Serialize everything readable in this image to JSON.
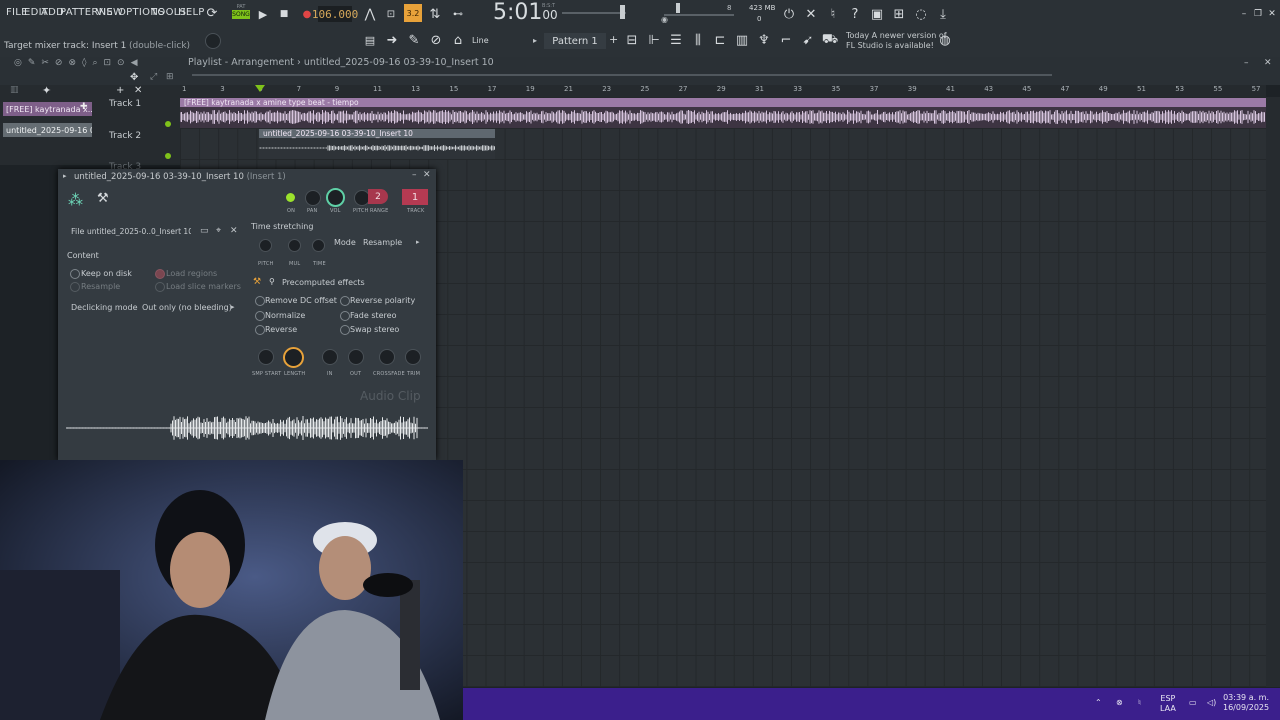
{
  "menu": [
    "FILE",
    "EDIT",
    "ADD",
    "PATTERNS",
    "VIEW",
    "OPTIONS",
    "TOOLS",
    "HELP"
  ],
  "song_mode": {
    "top": "PAT",
    "bottom": "SONG"
  },
  "bpm": "106.000",
  "step_display": "3.2",
  "time": {
    "main": "5:01",
    "sub": "00",
    "bar_label": "B:S:T"
  },
  "cpu": {
    "value": "8",
    "memory": "423 MB",
    "voices": "0"
  },
  "hint": {
    "left": "Target mixer track: Insert 1",
    "right": "(double-click)"
  },
  "tool_mode": "Line",
  "pattern": "Pattern 1",
  "news": {
    "line1": "Today  A newer version of",
    "line2": "FL Studio is available!"
  },
  "playlist": {
    "title": "Playlist - Arrangement",
    "separator": "›",
    "pattern_name": "untitled_2025-09-16 03-39-10_Insert 10",
    "ruler": [
      "1",
      "3",
      "5",
      "7",
      "9",
      "11",
      "13",
      "15",
      "17",
      "19",
      "21",
      "23",
      "25",
      "27",
      "29",
      "31",
      "33",
      "35",
      "37",
      "39",
      "41",
      "43",
      "45",
      "47",
      "49",
      "51",
      "53",
      "55",
      "57"
    ],
    "picker": [
      {
        "label": "[FREE] kaytranada x..."
      },
      {
        "label": "untitled_2025-09-16 03-..."
      }
    ],
    "tracks": [
      "Track 1",
      "Track 2",
      "Track 3"
    ],
    "clips": [
      {
        "label": "[FREE] kaytranada x amine type beat - tiempo",
        "color": "#9b7aa6"
      },
      {
        "label": "untitled_2025-09-16 03-39-10_Insert 10",
        "color": "#5f6870"
      }
    ]
  },
  "channel": {
    "title": "untitled_2025-09-16 03-39-10_Insert 10",
    "subtitle": "(Insert 1)",
    "knob_labels": [
      "ON",
      "PAN",
      "VOL",
      "PITCH",
      "RANGE",
      "TRACK"
    ],
    "range_value": "2",
    "track_value": "1",
    "file_label": "File",
    "file_name": "untitled_2025-0..0_Insert 10.wav",
    "content_label": "Content",
    "keep_on_disk": "Keep on disk",
    "load_regions": "Load regions",
    "resample": "Resample",
    "load_slice_markers": "Load slice markers",
    "declicking_label": "Declicking mode",
    "declicking_value": "Out only (no bleeding)",
    "time_stretching": "Time stretching",
    "ts_knobs": [
      "PITCH",
      "MUL",
      "TIME"
    ],
    "mode_label": "Mode",
    "mode_value": "Resample",
    "precomputed": "Precomputed effects",
    "effects_left": [
      "Remove DC offset",
      "Normalize",
      "Reverse"
    ],
    "effects_right": [
      "Reverse polarity",
      "Fade stereo",
      "Swap stereo"
    ],
    "bottom_knobs": [
      "SMP START",
      "LENGTH",
      "IN",
      "OUT",
      "CROSSFADE",
      "TRIM"
    ],
    "watermark": "Audio Clip"
  },
  "tray": {
    "lang_top": "ESP",
    "lang_bottom": "LAA",
    "time": "03:39 a. m.",
    "date": "16/09/2025"
  },
  "colors": {
    "accent_orange": "#e8a23a",
    "clip_purple": "#9b7aa6",
    "taskbar": "#3b1f8c"
  }
}
